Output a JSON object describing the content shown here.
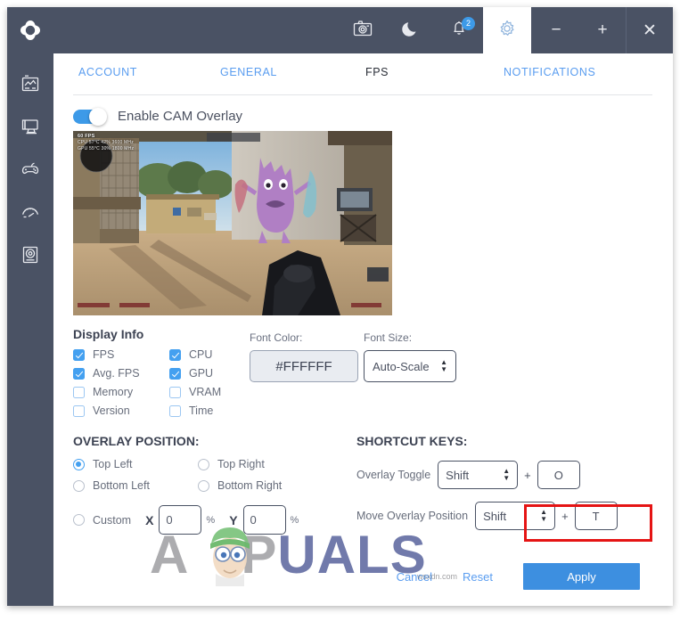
{
  "window": {
    "logo_icon": "nzxt-cam-logo",
    "controls": [
      {
        "name": "minimize",
        "glyph": "−"
      },
      {
        "name": "maximize",
        "glyph": "+"
      },
      {
        "name": "close",
        "glyph": "✕"
      }
    ]
  },
  "topbar": {
    "actions": [
      {
        "name": "screenshot-camera-icon",
        "label": "camera-icon"
      },
      {
        "name": "dark-mode-moon-icon",
        "label": "moon-icon"
      },
      {
        "name": "notifications-bell-icon",
        "label": "bell-icon",
        "badge": "2"
      },
      {
        "name": "settings-gear-icon",
        "label": "gear-icon",
        "active": true
      }
    ]
  },
  "sidebar": {
    "items": [
      {
        "name": "dashboard-icon",
        "label": "Dashboard"
      },
      {
        "name": "pc-monitoring-icon",
        "label": "PC Monitoring"
      },
      {
        "name": "gaming-icon",
        "label": "Gaming"
      },
      {
        "name": "tuning-icon",
        "label": "Tuning"
      },
      {
        "name": "lighting-icon",
        "label": "Lighting"
      }
    ]
  },
  "tabs": [
    {
      "id": "account",
      "label": "ACCOUNT",
      "active": false
    },
    {
      "id": "general",
      "label": "GENERAL",
      "active": false
    },
    {
      "id": "fps",
      "label": "FPS",
      "active": true
    },
    {
      "id": "notifications",
      "label": "NOTIFICATIONS",
      "active": false
    }
  ],
  "overlay_toggle": {
    "label": "Enable CAM Overlay",
    "enabled": true
  },
  "preview": {
    "overlay_fps": "60 FPS",
    "overlay_line1": "CPU  57°C  42%  3600 MHz",
    "overlay_line2": "GPU  55°C  30%  1800 MHz"
  },
  "display_info": {
    "title": "Display Info",
    "items": [
      {
        "id": "fps",
        "label": "FPS",
        "checked": true
      },
      {
        "id": "cpu",
        "label": "CPU",
        "checked": true
      },
      {
        "id": "avg_fps",
        "label": "Avg. FPS",
        "checked": true
      },
      {
        "id": "gpu",
        "label": "GPU",
        "checked": true
      },
      {
        "id": "memory",
        "label": "Memory",
        "checked": false
      },
      {
        "id": "vram",
        "label": "VRAM",
        "checked": false
      },
      {
        "id": "version",
        "label": "Version",
        "checked": false
      },
      {
        "id": "time",
        "label": "Time",
        "checked": false
      }
    ]
  },
  "font_color": {
    "label": "Font Color:",
    "value": "#FFFFFF"
  },
  "font_size": {
    "label": "Font Size:",
    "value": "Auto-Scale"
  },
  "overlay_position": {
    "title": "OVERLAY POSITION:",
    "options": [
      {
        "id": "top_left",
        "label": "Top Left",
        "selected": true
      },
      {
        "id": "top_right",
        "label": "Top Right",
        "selected": false
      },
      {
        "id": "bottom_left",
        "label": "Bottom Left",
        "selected": false
      },
      {
        "id": "bottom_right",
        "label": "Bottom Right",
        "selected": false
      }
    ],
    "custom": {
      "label": "Custom",
      "selected": false,
      "x_label": "X",
      "x_value": "0",
      "y_label": "Y",
      "y_value": "0",
      "unit": "%"
    }
  },
  "shortcuts": {
    "title": "SHORTCUT KEYS:",
    "rows": [
      {
        "id": "overlay_toggle",
        "label": "Overlay Toggle",
        "modifier": "Shift",
        "plus": "+",
        "key": "O"
      },
      {
        "id": "move_overlay",
        "label": "Move Overlay Position",
        "modifier": "Shift",
        "plus": "+",
        "key": "T"
      }
    ]
  },
  "footer": {
    "cancel": "Cancel",
    "reset": "Reset",
    "apply": "Apply"
  },
  "watermark": {
    "text_a": "A",
    "text_pp": "P",
    "text_u": "U",
    "text_als": "ALS",
    "full": "APPUALS",
    "sub": "wsxdn.com"
  },
  "colors": {
    "dark_chrome": "#4a5264",
    "accent_blue": "#3d9ae8",
    "link_blue": "#5a9df0",
    "apply_blue": "#3d8fe0",
    "highlight_red": "#e51414",
    "input_bg": "#e9ecf1"
  }
}
